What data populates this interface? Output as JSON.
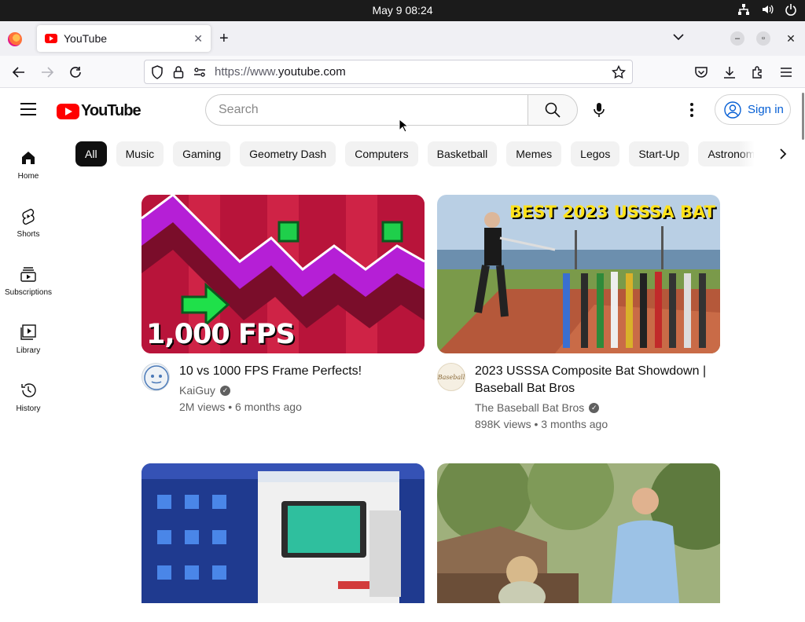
{
  "system": {
    "clock": "May 9  08:24"
  },
  "browser": {
    "tab_title": "YouTube",
    "url_prefix": "https://www.",
    "url_domain": "youtube.com"
  },
  "youtube": {
    "logo_text": "YouTube",
    "search_placeholder": "Search",
    "sign_in": "Sign in",
    "guide": [
      {
        "label": "Home",
        "icon": "home-icon"
      },
      {
        "label": "Shorts",
        "icon": "shorts-icon"
      },
      {
        "label": "Subscriptions",
        "icon": "subscriptions-icon"
      },
      {
        "label": "Library",
        "icon": "library-icon"
      },
      {
        "label": "History",
        "icon": "history-icon"
      }
    ],
    "chips": [
      "All",
      "Music",
      "Gaming",
      "Geometry Dash",
      "Computers",
      "Basketball",
      "Memes",
      "Legos",
      "Start-Up",
      "Astronomy"
    ],
    "videos": [
      {
        "title": "10 vs 1000 FPS Frame Perfects!",
        "channel": "KaiGuy",
        "views": "2M views",
        "age": "6 months ago",
        "thumb_text": "1,000 FPS"
      },
      {
        "title": "2023 USSSA Composite Bat Showdown | Baseball Bat Bros",
        "channel": "The Baseball Bat Bros",
        "views": "898K views",
        "age": "3 months ago",
        "thumb_text": "BEST 2023 USSSA BAT",
        "avatar_text": "Baseball"
      }
    ]
  },
  "colors": {
    "youtube_red": "#ff0000",
    "signin_blue": "#065fd4",
    "chip_active": "#0f0f0f"
  }
}
